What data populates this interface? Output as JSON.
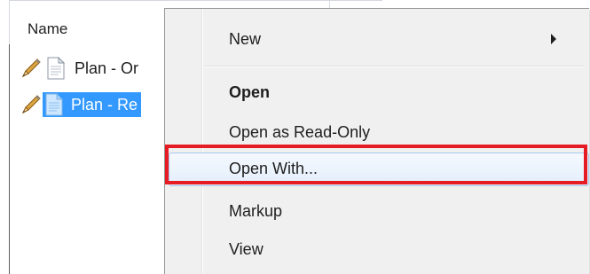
{
  "explorer": {
    "column_header": "Name",
    "files": [
      {
        "name": "Plan - Or",
        "selected": false
      },
      {
        "name": "Plan - Re",
        "selected": true
      }
    ]
  },
  "context_menu": {
    "items": [
      {
        "label": "New",
        "has_submenu": true,
        "bold": false
      },
      {
        "label": "Open",
        "has_submenu": false,
        "bold": true
      },
      {
        "label": "Open as Read-Only",
        "has_submenu": false,
        "bold": false
      },
      {
        "label": "Open With...",
        "has_submenu": false,
        "bold": false,
        "highlighted": true
      },
      {
        "label": "Markup",
        "has_submenu": false,
        "bold": false
      },
      {
        "label": "View",
        "has_submenu": false,
        "bold": false
      }
    ]
  },
  "colors": {
    "selection": "#3399ff",
    "callout_border": "#e51c23",
    "menu_background": "#f0f0f0"
  },
  "icons": [
    "pencil-icon",
    "document-icon",
    "submenu-arrow-icon"
  ]
}
